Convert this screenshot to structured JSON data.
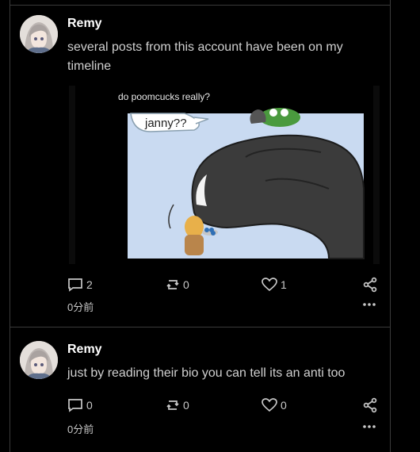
{
  "posts": [
    {
      "author": "Remy",
      "text": "several posts from this account have been on my timeline",
      "image": {
        "caption": "do poomcucks really?",
        "bubble_text": "janny??"
      },
      "reply_count": "2",
      "renote_count": "0",
      "reaction_count": "1",
      "time": "0分前"
    },
    {
      "author": "Remy",
      "text": "just by reading their bio you can tell its an anti too",
      "reply_count": "0",
      "renote_count": "0",
      "reaction_count": "0",
      "time": "0分前"
    }
  ],
  "icons": {
    "reply": "reply-icon",
    "renote": "renote-icon",
    "reaction": "heart-icon",
    "share": "share-icon",
    "more": "more-icon"
  }
}
